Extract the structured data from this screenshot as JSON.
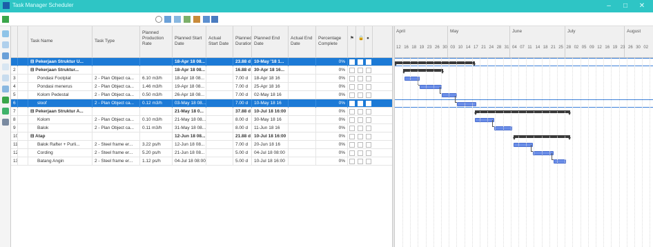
{
  "window": {
    "title": "Task Manager Scheduler"
  },
  "columns": [
    {
      "label": "Task Name"
    },
    {
      "label": "Task Type"
    },
    {
      "label": "Planned Production Rate"
    },
    {
      "label": "Planned Start Date"
    },
    {
      "label": "Actual Start Date"
    },
    {
      "label": "Planned Duration"
    },
    {
      "label": "Planned End Date"
    },
    {
      "label": "Actual End Date"
    },
    {
      "label": "Percentage Complete"
    }
  ],
  "rows": [
    {
      "num": "",
      "name": "⊟ Pekerjaan Struktur U...",
      "type": "",
      "rate": "",
      "start": "18-Apr 18 08...",
      "astart": "",
      "dur": "23.88 d",
      "end": "10-May '18 1...",
      "aend": "",
      "pct": "0%",
      "bold": true,
      "selected": true,
      "indent": 0
    },
    {
      "num": "2",
      "name": "⊟ Pekerjaan Struktur...",
      "type": "",
      "rate": "",
      "start": "18-Apr 18 08...",
      "astart": "",
      "dur": "16.88 d",
      "end": "30-Apr 18 16...",
      "aend": "",
      "pct": "0%",
      "bold": true,
      "selected": false,
      "indent": 0
    },
    {
      "num": "3",
      "name": "Pondasi Footplat",
      "type": "2 - Plan Object ca...",
      "rate": "6.10 m3/h",
      "start": "18-Apr 18 08...",
      "astart": "",
      "dur": "7.00 d",
      "end": "18-Apr 18 16",
      "aend": "",
      "pct": "0%",
      "bold": false,
      "selected": false,
      "indent": 1
    },
    {
      "num": "4",
      "name": "Pondasi menerus",
      "type": "2 - Plan Object ca...",
      "rate": "1.46 m3/h",
      "start": "19-Apr 18 08...",
      "astart": "",
      "dur": "7.00 d",
      "end": "25-Apr 18 16",
      "aend": "",
      "pct": "0%",
      "bold": false,
      "selected": false,
      "indent": 1
    },
    {
      "num": "5",
      "name": "Kolom Pedestal",
      "type": "2 - Plan Object ca...",
      "rate": "0.50 m3/h",
      "start": "26-Apr 18 08...",
      "astart": "",
      "dur": "7.00 d",
      "end": "02-May 18 16",
      "aend": "",
      "pct": "0%",
      "bold": false,
      "selected": false,
      "indent": 1
    },
    {
      "num": "6",
      "name": "sloof",
      "type": "2 - Plan Object ca...",
      "rate": "0.12 m3/h",
      "start": "03-May 18 08...",
      "astart": "",
      "dur": "7.00 d",
      "end": "10-May 18 16",
      "aend": "",
      "pct": "0%",
      "bold": false,
      "selected": true,
      "indent": 1
    },
    {
      "num": "7",
      "name": "⊟ Pekerjaan Struktur A...",
      "type": "",
      "rate": "",
      "start": "21-May 18 0...",
      "astart": "",
      "dur": "37.88 d",
      "end": "10-Jul 18 16:00",
      "aend": "",
      "pct": "0%",
      "bold": true,
      "selected": false,
      "indent": 0
    },
    {
      "num": "8",
      "name": "Kolom",
      "type": "2 - Plan Object ca...",
      "rate": "0.10 m3/h",
      "start": "21-May 18 08...",
      "astart": "",
      "dur": "8.00 d",
      "end": "30-May 18 16",
      "aend": "",
      "pct": "0%",
      "bold": false,
      "selected": false,
      "indent": 1
    },
    {
      "num": "9",
      "name": "Balok",
      "type": "2 - Plan Object ca...",
      "rate": "0.11 m3/h",
      "start": "31-May 18 08...",
      "astart": "",
      "dur": "8.00 d",
      "end": "11-Jun 18 16",
      "aend": "",
      "pct": "0%",
      "bold": false,
      "selected": false,
      "indent": 1
    },
    {
      "num": "10",
      "name": "⊟ Atap",
      "type": "",
      "rate": "",
      "start": "12-Jun 18 08...",
      "astart": "",
      "dur": "21.88 d",
      "end": "10-Jul 18 16:00",
      "aend": "",
      "pct": "0%",
      "bold": true,
      "selected": false,
      "indent": 0
    },
    {
      "num": "11",
      "name": "Balok Rafter + Purli...",
      "type": "2 - Steel frame er...",
      "rate": "3.22 ps/h",
      "start": "12-Jun 18 08...",
      "astart": "",
      "dur": "7.00 d",
      "end": "20-Jun 18 16",
      "aend": "",
      "pct": "0%",
      "bold": false,
      "selected": false,
      "indent": 1
    },
    {
      "num": "12",
      "name": "Cording",
      "type": "2 - Steel frame er...",
      "rate": "5.20 ps/h",
      "start": "21-Jun 18 08...",
      "astart": "",
      "dur": "5.00 d",
      "end": "04-Jul 18 08:00",
      "aend": "",
      "pct": "0%",
      "bold": false,
      "selected": false,
      "indent": 1
    },
    {
      "num": "13",
      "name": "Batang Angin",
      "type": "2 - Steel frame er...",
      "rate": "1.12 ps/h",
      "start": "04-Jul 18 08:00",
      "astart": "",
      "dur": "5.00 d",
      "end": "10-Jul 18 16:00",
      "aend": "",
      "pct": "0%",
      "bold": false,
      "selected": false,
      "indent": 1
    }
  ],
  "gantt": {
    "months": [
      "April",
      "May",
      "June",
      "July",
      "August"
    ],
    "weeks": [
      "12",
      "16",
      "18",
      "19",
      "23",
      "26",
      "30",
      "03",
      "10",
      "14",
      "17",
      "21",
      "24",
      "28",
      "31",
      "04",
      "07",
      "11",
      "14",
      "18",
      "21",
      "25",
      "28",
      "02",
      "05",
      "09",
      "12",
      "16",
      "19",
      "23",
      "26",
      "30",
      "02"
    ]
  }
}
